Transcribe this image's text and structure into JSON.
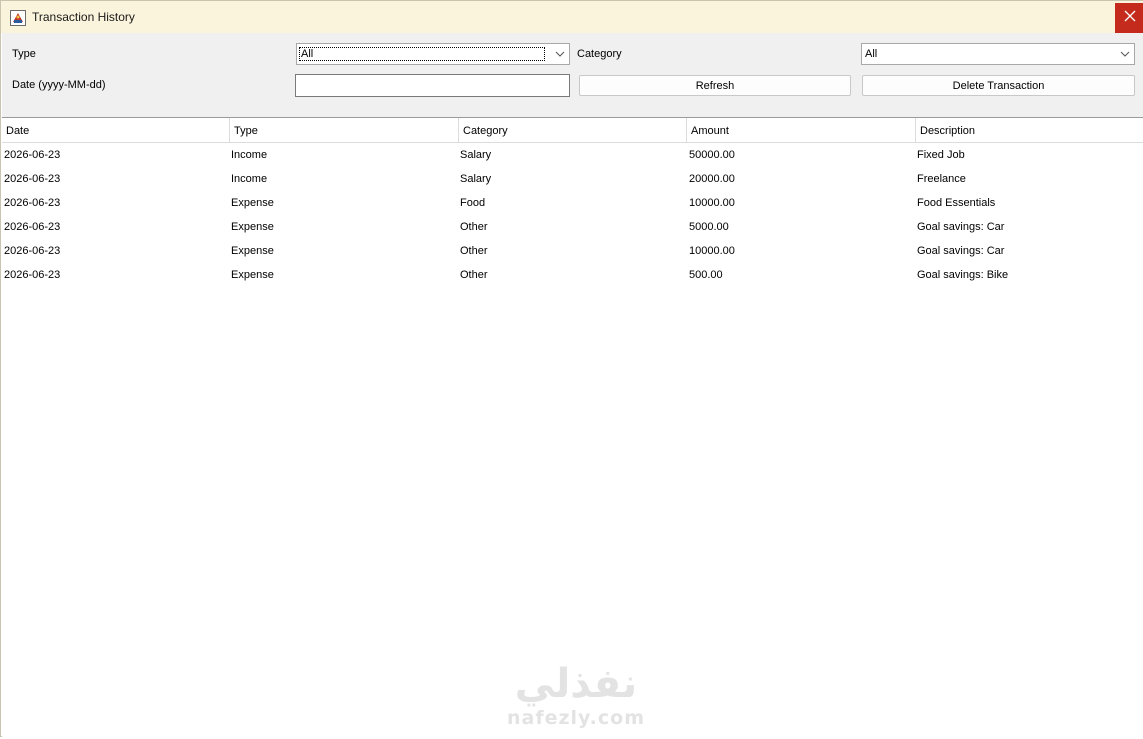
{
  "window": {
    "title": "Transaction History",
    "icon": "java-app-icon",
    "close_icon": "close-icon"
  },
  "filters": {
    "type_label": "Type",
    "type_value": "All",
    "category_label": "Category",
    "category_value": "All",
    "date_label": "Date (yyyy-MM-dd)",
    "date_value": "",
    "refresh_label": "Refresh",
    "delete_label": "Delete Transaction"
  },
  "table": {
    "columns": [
      "Date",
      "Type",
      "Category",
      "Amount",
      "Description"
    ],
    "rows": [
      [
        "2026-06-23",
        "Income",
        "Salary",
        "50000.00",
        "Fixed Job"
      ],
      [
        "2026-06-23",
        "Income",
        "Salary",
        "20000.00",
        "Freelance"
      ],
      [
        "2026-06-23",
        "Expense",
        "Food",
        "10000.00",
        "Food Essentials"
      ],
      [
        "2026-06-23",
        "Expense",
        "Other",
        "5000.00",
        "Goal savings: Car"
      ],
      [
        "2026-06-23",
        "Expense",
        "Other",
        "10000.00",
        "Goal savings: Car"
      ],
      [
        "2026-06-23",
        "Expense",
        "Other",
        "500.00",
        "Goal savings: Bike"
      ]
    ]
  },
  "watermark": {
    "arabic": "نفذلي",
    "latin": "nafezly.com"
  },
  "colors": {
    "titlebar": "#fbf4dc",
    "close_button": "#c42b1c",
    "panel": "#f0f0f0"
  }
}
